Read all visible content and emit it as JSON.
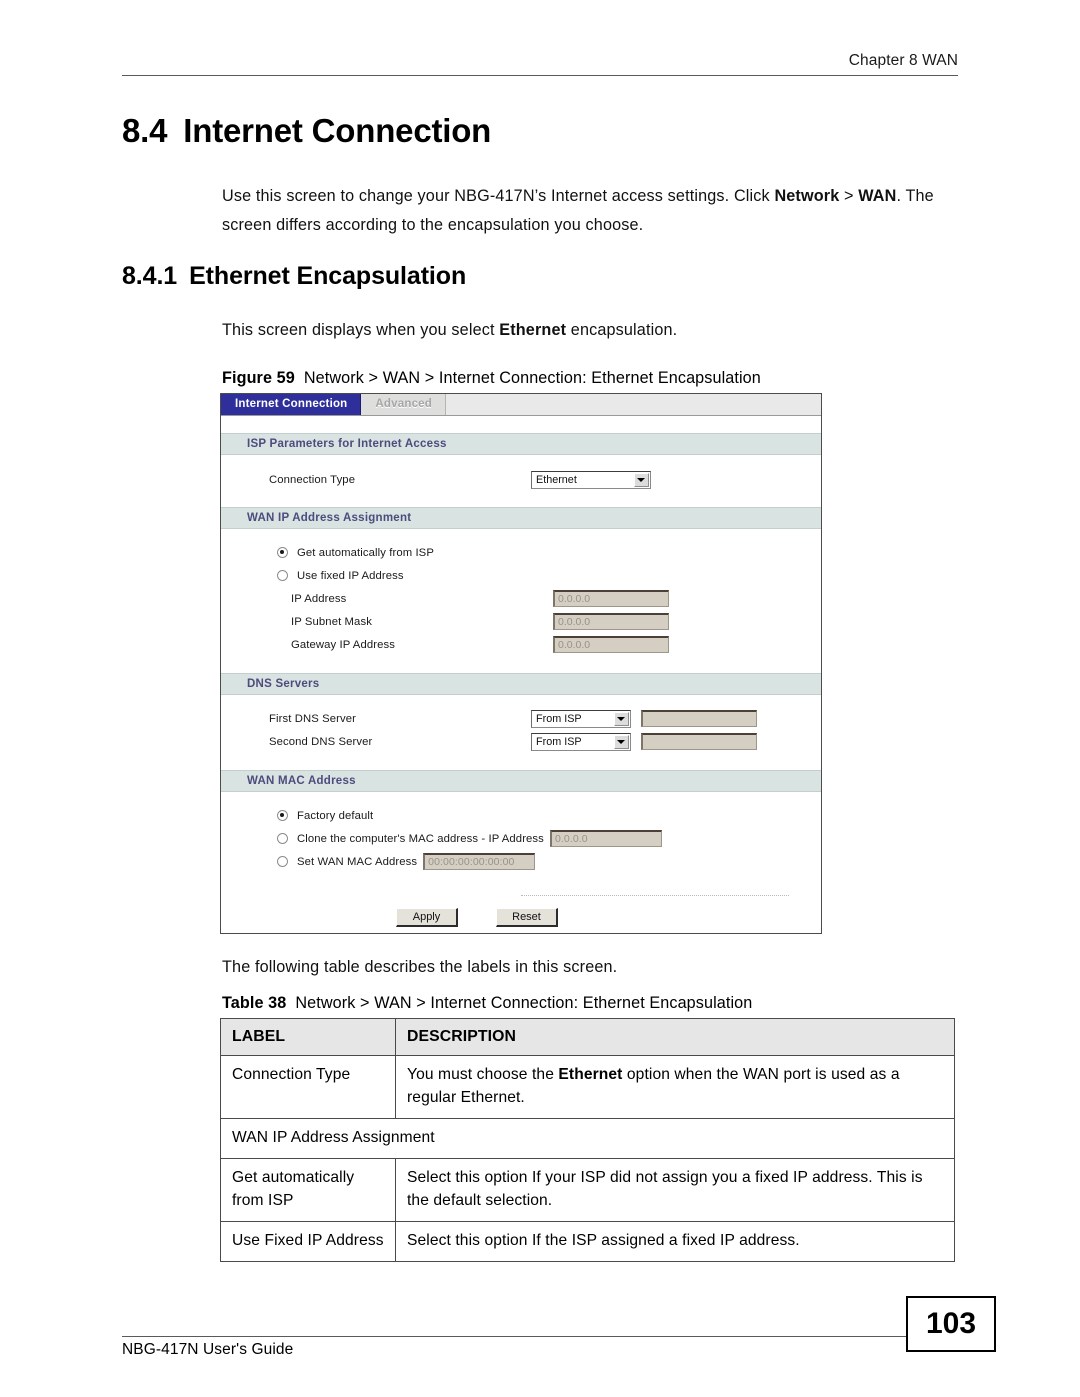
{
  "header": {
    "chapter": "Chapter 8 WAN"
  },
  "headings": {
    "section_number": "8.4",
    "section_title": "Internet Connection",
    "subsection_number": "8.4.1",
    "subsection_title": "Ethernet Encapsulation"
  },
  "paragraphs": {
    "intro_part1": "Use this screen to change your NBG-417N’s Internet access settings. Click ",
    "intro_bold1": "Network",
    "intro_mid": " > ",
    "intro_bold2": "WAN",
    "intro_part2": ". The screen differs according to the encapsulation you choose.",
    "ethernet_part1": "This screen displays when you select ",
    "ethernet_bold": "Ethernet",
    "ethernet_part2": " encapsulation.",
    "table_intro": "The following table describes the labels in this screen."
  },
  "figure": {
    "caption_number": "Figure 59",
    "caption_text": "Network > WAN > Internet Connection: Ethernet Encapsulation"
  },
  "router_ui": {
    "tabs": [
      {
        "label": "Internet Connection",
        "active": true
      },
      {
        "label": "Advanced",
        "active": false
      }
    ],
    "sections": {
      "isp_params": "ISP Parameters for Internet Access",
      "wan_ip": "WAN IP Address Assignment",
      "dns_servers": "DNS Servers",
      "wan_mac": "WAN MAC Address"
    },
    "connection_type": {
      "label": "Connection Type",
      "value": "Ethernet",
      "options": [
        "Ethernet"
      ]
    },
    "wan_ip_assignment": {
      "option_auto": "Get automatically from ISP",
      "option_fixed": "Use fixed IP Address",
      "selected": "Get automatically from ISP",
      "ip_address_label": "IP Address",
      "ip_address_value": "0.0.0.0",
      "subnet_mask_label": "IP Subnet Mask",
      "subnet_mask_value": "0.0.0.0",
      "gateway_label": "Gateway IP Address",
      "gateway_value": "0.0.0.0"
    },
    "dns": {
      "first_label": "First DNS Server",
      "first_value": "From ISP",
      "first_ip": "",
      "second_label": "Second DNS Server",
      "second_value": "From ISP",
      "second_ip": "",
      "options": [
        "From ISP"
      ]
    },
    "wan_mac": {
      "option_factory": "Factory default",
      "option_clone": "Clone the computer's MAC address - IP Address",
      "clone_ip_value": "0.0.0.0",
      "option_set": "Set WAN MAC Address",
      "set_mac_value": "00:00:00:00:00:00",
      "selected": "Factory default"
    },
    "buttons": {
      "apply": "Apply",
      "reset": "Reset"
    },
    "colors": {
      "active_tab": "#2f2f9c",
      "section_header_bg": "#d9e3e2",
      "section_header_text": "#4c4c7d",
      "disabled_input_bg": "#d4cec3"
    }
  },
  "table": {
    "caption_number": "Table 38",
    "caption_text": "Network > WAN > Internet Connection: Ethernet Encapsulation",
    "headers": [
      "LABEL",
      "DESCRIPTION"
    ],
    "rows": [
      {
        "type": "normal",
        "label": "Connection Type",
        "desc_part1": "You must choose the ",
        "desc_bold": "Ethernet",
        "desc_part2": " option when the WAN port is used as a regular Ethernet."
      },
      {
        "type": "span",
        "label": "WAN IP Address Assignment"
      },
      {
        "type": "plain",
        "label": "Get automatically from ISP",
        "description": "Select this option If your ISP did not assign you a fixed IP address. This is the default selection."
      },
      {
        "type": "plain",
        "label": "Use Fixed IP Address",
        "description": "Select this option If the ISP assigned a fixed IP address."
      }
    ]
  },
  "footer": {
    "guide_title": "NBG-417N User's Guide",
    "page_number": "103"
  }
}
